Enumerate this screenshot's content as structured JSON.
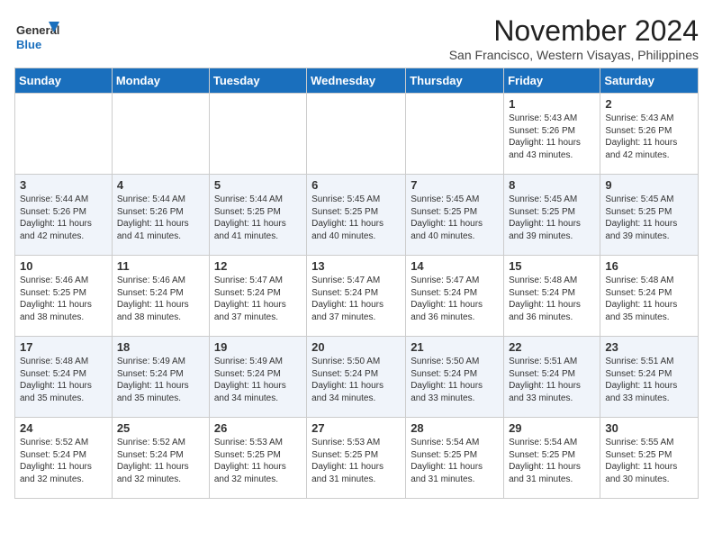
{
  "header": {
    "logo_general": "General",
    "logo_blue": "Blue",
    "month_title": "November 2024",
    "subtitle": "San Francisco, Western Visayas, Philippines"
  },
  "days_of_week": [
    "Sunday",
    "Monday",
    "Tuesday",
    "Wednesday",
    "Thursday",
    "Friday",
    "Saturday"
  ],
  "weeks": [
    [
      {
        "day": "",
        "info": ""
      },
      {
        "day": "",
        "info": ""
      },
      {
        "day": "",
        "info": ""
      },
      {
        "day": "",
        "info": ""
      },
      {
        "day": "",
        "info": ""
      },
      {
        "day": "1",
        "info": "Sunrise: 5:43 AM\nSunset: 5:26 PM\nDaylight: 11 hours and 43 minutes."
      },
      {
        "day": "2",
        "info": "Sunrise: 5:43 AM\nSunset: 5:26 PM\nDaylight: 11 hours and 42 minutes."
      }
    ],
    [
      {
        "day": "3",
        "info": "Sunrise: 5:44 AM\nSunset: 5:26 PM\nDaylight: 11 hours and 42 minutes."
      },
      {
        "day": "4",
        "info": "Sunrise: 5:44 AM\nSunset: 5:26 PM\nDaylight: 11 hours and 41 minutes."
      },
      {
        "day": "5",
        "info": "Sunrise: 5:44 AM\nSunset: 5:25 PM\nDaylight: 11 hours and 41 minutes."
      },
      {
        "day": "6",
        "info": "Sunrise: 5:45 AM\nSunset: 5:25 PM\nDaylight: 11 hours and 40 minutes."
      },
      {
        "day": "7",
        "info": "Sunrise: 5:45 AM\nSunset: 5:25 PM\nDaylight: 11 hours and 40 minutes."
      },
      {
        "day": "8",
        "info": "Sunrise: 5:45 AM\nSunset: 5:25 PM\nDaylight: 11 hours and 39 minutes."
      },
      {
        "day": "9",
        "info": "Sunrise: 5:45 AM\nSunset: 5:25 PM\nDaylight: 11 hours and 39 minutes."
      }
    ],
    [
      {
        "day": "10",
        "info": "Sunrise: 5:46 AM\nSunset: 5:25 PM\nDaylight: 11 hours and 38 minutes."
      },
      {
        "day": "11",
        "info": "Sunrise: 5:46 AM\nSunset: 5:24 PM\nDaylight: 11 hours and 38 minutes."
      },
      {
        "day": "12",
        "info": "Sunrise: 5:47 AM\nSunset: 5:24 PM\nDaylight: 11 hours and 37 minutes."
      },
      {
        "day": "13",
        "info": "Sunrise: 5:47 AM\nSunset: 5:24 PM\nDaylight: 11 hours and 37 minutes."
      },
      {
        "day": "14",
        "info": "Sunrise: 5:47 AM\nSunset: 5:24 PM\nDaylight: 11 hours and 36 minutes."
      },
      {
        "day": "15",
        "info": "Sunrise: 5:48 AM\nSunset: 5:24 PM\nDaylight: 11 hours and 36 minutes."
      },
      {
        "day": "16",
        "info": "Sunrise: 5:48 AM\nSunset: 5:24 PM\nDaylight: 11 hours and 35 minutes."
      }
    ],
    [
      {
        "day": "17",
        "info": "Sunrise: 5:48 AM\nSunset: 5:24 PM\nDaylight: 11 hours and 35 minutes."
      },
      {
        "day": "18",
        "info": "Sunrise: 5:49 AM\nSunset: 5:24 PM\nDaylight: 11 hours and 35 minutes."
      },
      {
        "day": "19",
        "info": "Sunrise: 5:49 AM\nSunset: 5:24 PM\nDaylight: 11 hours and 34 minutes."
      },
      {
        "day": "20",
        "info": "Sunrise: 5:50 AM\nSunset: 5:24 PM\nDaylight: 11 hours and 34 minutes."
      },
      {
        "day": "21",
        "info": "Sunrise: 5:50 AM\nSunset: 5:24 PM\nDaylight: 11 hours and 33 minutes."
      },
      {
        "day": "22",
        "info": "Sunrise: 5:51 AM\nSunset: 5:24 PM\nDaylight: 11 hours and 33 minutes."
      },
      {
        "day": "23",
        "info": "Sunrise: 5:51 AM\nSunset: 5:24 PM\nDaylight: 11 hours and 33 minutes."
      }
    ],
    [
      {
        "day": "24",
        "info": "Sunrise: 5:52 AM\nSunset: 5:24 PM\nDaylight: 11 hours and 32 minutes."
      },
      {
        "day": "25",
        "info": "Sunrise: 5:52 AM\nSunset: 5:24 PM\nDaylight: 11 hours and 32 minutes."
      },
      {
        "day": "26",
        "info": "Sunrise: 5:53 AM\nSunset: 5:25 PM\nDaylight: 11 hours and 32 minutes."
      },
      {
        "day": "27",
        "info": "Sunrise: 5:53 AM\nSunset: 5:25 PM\nDaylight: 11 hours and 31 minutes."
      },
      {
        "day": "28",
        "info": "Sunrise: 5:54 AM\nSunset: 5:25 PM\nDaylight: 11 hours and 31 minutes."
      },
      {
        "day": "29",
        "info": "Sunrise: 5:54 AM\nSunset: 5:25 PM\nDaylight: 11 hours and 31 minutes."
      },
      {
        "day": "30",
        "info": "Sunrise: 5:55 AM\nSunset: 5:25 PM\nDaylight: 11 hours and 30 minutes."
      }
    ]
  ]
}
